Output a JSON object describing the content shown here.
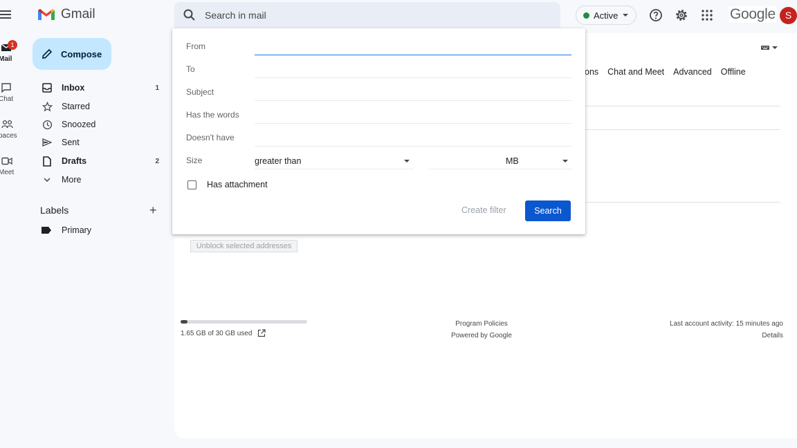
{
  "app": {
    "name": "Gmail",
    "brand_color": "#0b57d0"
  },
  "rail": {
    "mail_label": "Mail",
    "mail_badge": "1",
    "chat_label": "Chat",
    "spaces_label": "paces",
    "meet_label": "Meet"
  },
  "header": {
    "search_placeholder": "Search in mail",
    "status_label": "Active",
    "google_text": "Google",
    "avatar_letter": "S"
  },
  "nav": {
    "compose_label": "Compose",
    "items": [
      {
        "label": "Inbox",
        "count": "1",
        "icon": "inbox-icon"
      },
      {
        "label": "Starred",
        "count": "",
        "icon": "star-icon"
      },
      {
        "label": "Snoozed",
        "count": "",
        "icon": "clock-icon"
      },
      {
        "label": "Sent",
        "count": "",
        "icon": "send-icon"
      },
      {
        "label": "Drafts",
        "count": "2",
        "icon": "draft-icon"
      },
      {
        "label": "More",
        "count": "",
        "icon": "chevron-down-icon"
      }
    ],
    "labels_title": "Labels",
    "labels": [
      {
        "label": "Primary"
      }
    ]
  },
  "settings_tabs": {
    "partial": "ons",
    "chat_meet": "Chat and Meet",
    "advanced": "Advanced",
    "offline": "Offline"
  },
  "main": {
    "unblock_button": "Unblock selected addresses"
  },
  "footer": {
    "storage_text": "1.65 GB of 30 GB used",
    "storage_fraction": 0.055,
    "program_policies": "Program Policies",
    "powered_by": "Powered by Google",
    "last_activity": "Last account activity: 15 minutes ago",
    "details": "Details"
  },
  "search_options": {
    "from_label": "From",
    "to_label": "To",
    "subject_label": "Subject",
    "has_words_label": "Has the words",
    "doesnt_have_label": "Doesn't have",
    "size_label": "Size",
    "size_operator": "greater than",
    "size_unit": "MB",
    "has_attachment_label": "Has attachment",
    "create_filter_label": "Create filter",
    "search_button_label": "Search"
  }
}
